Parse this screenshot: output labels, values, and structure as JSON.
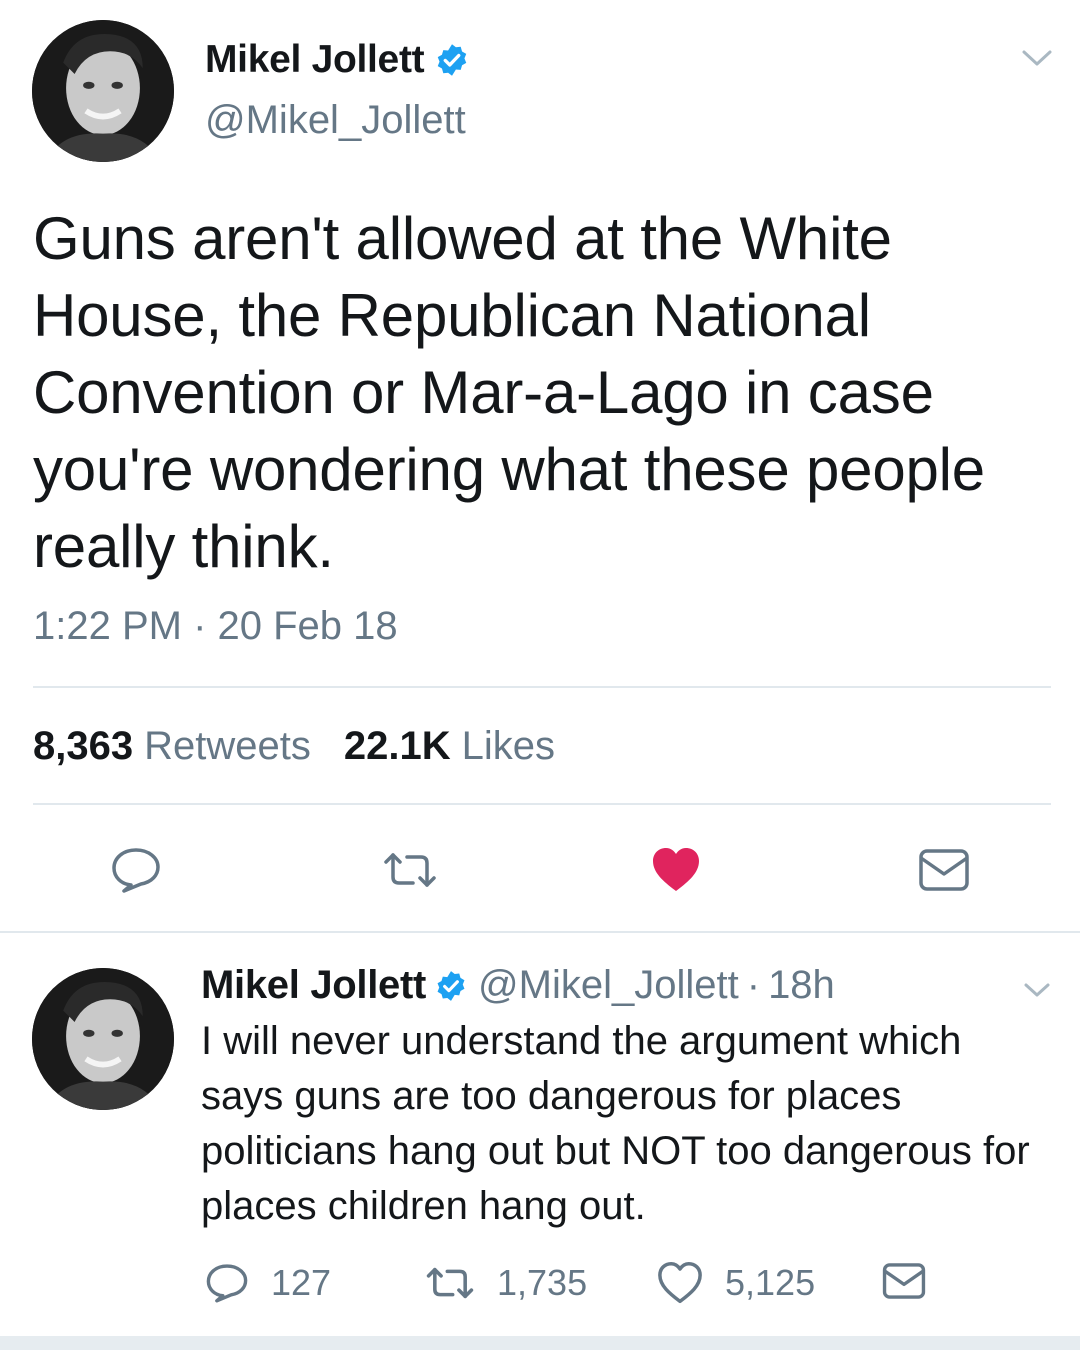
{
  "main_tweet": {
    "display_name": "Mikel Jollett",
    "handle": "@Mikel_Jollett",
    "text": "Guns aren't allowed at the White House, the Republican National Convention or Mar-a-Lago in case you're wondering what these people really think.",
    "timestamp": "1:22 PM · 20 Feb 18",
    "retweet_count": "8,363",
    "retweet_label": "Retweets",
    "like_count": "22.1K",
    "like_label": "Likes",
    "liked": true,
    "actions": [
      "reply-icon",
      "retweet-icon",
      "heart-icon",
      "dm-icon"
    ]
  },
  "reply_tweet": {
    "display_name": "Mikel Jollett",
    "handle": "@Mikel_Jollett",
    "separator": "·",
    "age": "18h",
    "text": "I will never understand the argument which says guns are too dangerous for places politicians hang out but NOT too dangerous for places children hang out.",
    "reply_count": "127",
    "retweet_count": "1,735",
    "like_count": "5,125"
  },
  "colors": {
    "text_primary": "#14171a",
    "text_secondary": "#657786",
    "verified_blue": "#1da1f2",
    "like_red": "#e0245e",
    "divider": "#e1e8ed",
    "icon_gray": "#657786"
  }
}
